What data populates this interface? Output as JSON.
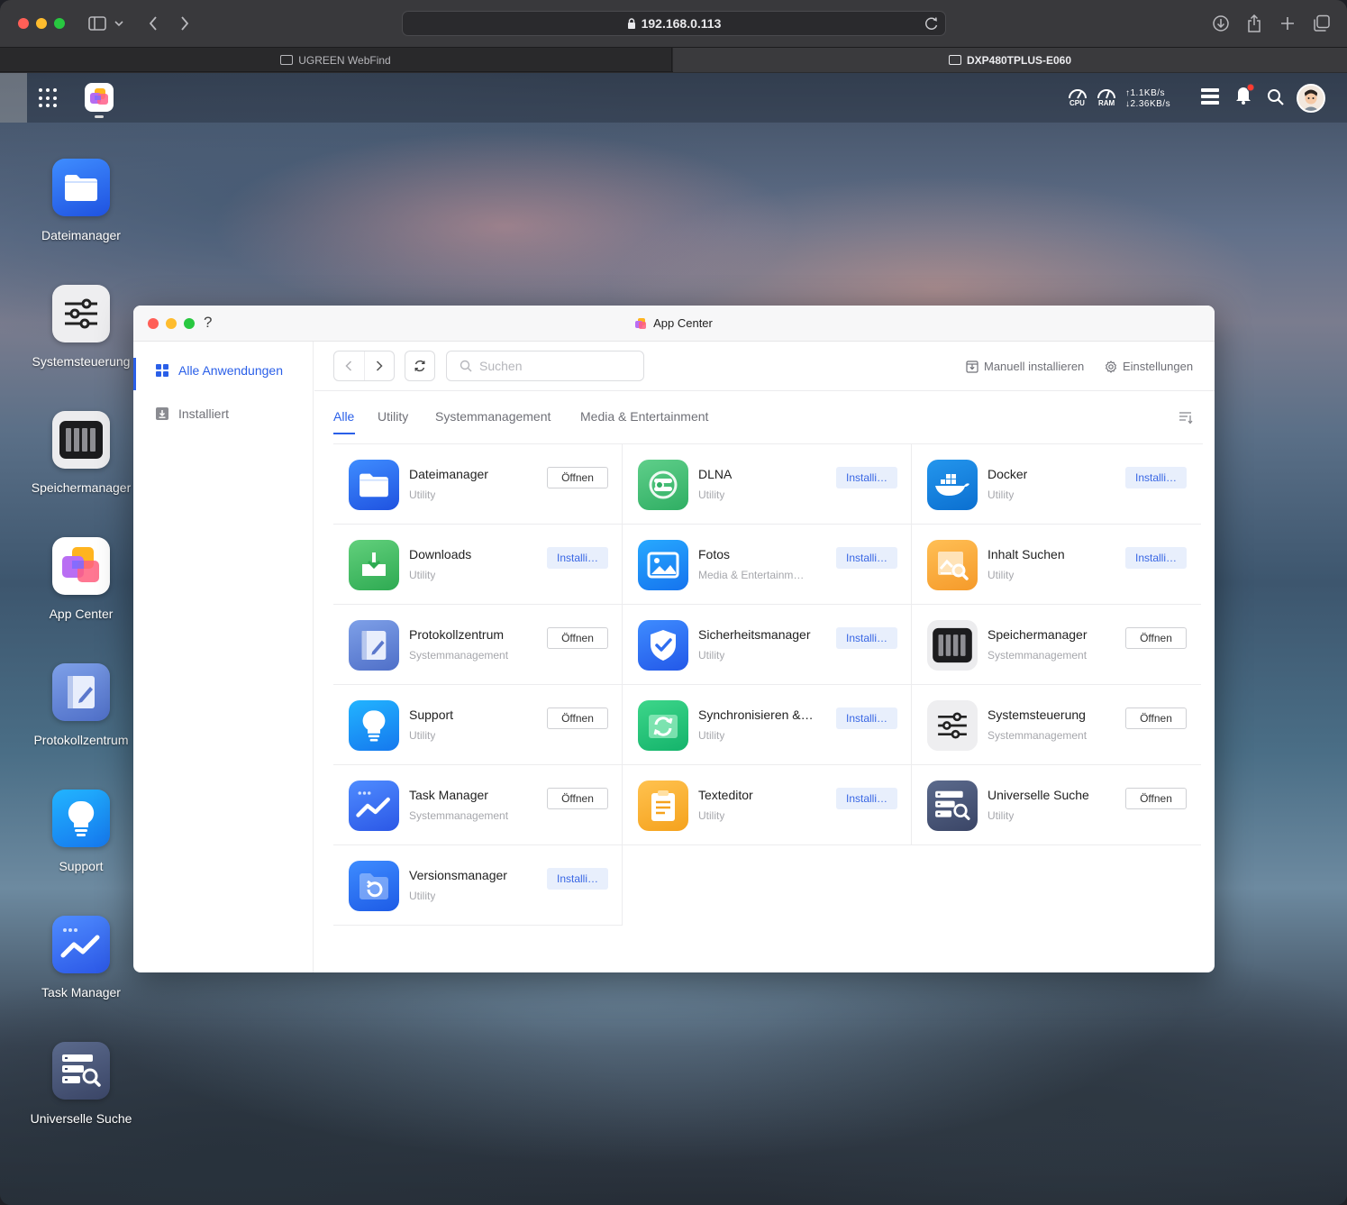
{
  "browser": {
    "url": "192.168.0.113",
    "tabs": [
      {
        "label": "UGREEN WebFind",
        "active": false
      },
      {
        "label": "DXP480TPLUS-E060",
        "active": true
      }
    ]
  },
  "system_bar": {
    "cpu_label": "CPU",
    "ram_label": "RAM",
    "upload": "↑1.1KB/s",
    "download": "↓2.36KB/s"
  },
  "desktop_icons": [
    {
      "label": "Dateimanager",
      "icon": "folder-icon"
    },
    {
      "label": "Systemsteuerung",
      "icon": "sliders-icon"
    },
    {
      "label": "Speichermanager",
      "icon": "storage-drive-icon"
    },
    {
      "label": "App Center",
      "icon": "app-center-icon"
    },
    {
      "label": "Protokollzentrum",
      "icon": "log-book-icon"
    },
    {
      "label": "Support",
      "icon": "lightbulb-icon"
    },
    {
      "label": "Task Manager",
      "icon": "chart-trend-icon"
    },
    {
      "label": "Universelle Suche",
      "icon": "search-database-icon"
    }
  ],
  "window": {
    "title": "App Center",
    "help": "?",
    "sidebar": [
      {
        "label": "Alle Anwendungen",
        "active": true
      },
      {
        "label": "Installiert",
        "active": false
      }
    ],
    "search_placeholder": "Suchen",
    "manual_install": "Manuell installieren",
    "settings": "Einstellungen",
    "categories": [
      {
        "label": "Alle",
        "active": true
      },
      {
        "label": "Utility",
        "active": false
      },
      {
        "label": "Systemmanagement",
        "active": false
      },
      {
        "label": "Media & Entertainment",
        "active": false
      }
    ],
    "apps": [
      {
        "name": "Dateimanager",
        "category": "Utility",
        "action": "Öffnen",
        "state": "open",
        "icon": "folder-icon"
      },
      {
        "name": "DLNA",
        "category": "Utility",
        "action": "Installi…",
        "state": "install",
        "icon": "dlna-icon"
      },
      {
        "name": "Docker",
        "category": "Utility",
        "action": "Installi…",
        "state": "install",
        "icon": "docker-whale-icon"
      },
      {
        "name": "Downloads",
        "category": "Utility",
        "action": "Installi…",
        "state": "install",
        "icon": "download-icon"
      },
      {
        "name": "Fotos",
        "category": "Media & Entertainm…",
        "action": "Installi…",
        "state": "install",
        "icon": "photo-icon"
      },
      {
        "name": "Inhalt Suchen",
        "category": "Utility",
        "action": "Installi…",
        "state": "install",
        "icon": "content-search-icon"
      },
      {
        "name": "Protokollzentrum",
        "category": "Systemmanagement",
        "action": "Öffnen",
        "state": "open",
        "icon": "log-book-icon"
      },
      {
        "name": "Sicherheitsmanager",
        "category": "Utility",
        "action": "Installi…",
        "state": "install",
        "icon": "shield-check-icon"
      },
      {
        "name": "Speichermanager",
        "category": "Systemmanagement",
        "action": "Öffnen",
        "state": "open",
        "icon": "storage-drive-icon"
      },
      {
        "name": "Support",
        "category": "Utility",
        "action": "Öffnen",
        "state": "open",
        "icon": "lightbulb-icon"
      },
      {
        "name": "Synchronisieren &…",
        "category": "Utility",
        "action": "Installi…",
        "state": "install",
        "icon": "sync-icon"
      },
      {
        "name": "Systemsteuerung",
        "category": "Systemmanagement",
        "action": "Öffnen",
        "state": "open",
        "icon": "sliders-icon"
      },
      {
        "name": "Task Manager",
        "category": "Systemmanagement",
        "action": "Öffnen",
        "state": "open",
        "icon": "chart-trend-icon"
      },
      {
        "name": "Texteditor",
        "category": "Utility",
        "action": "Installi…",
        "state": "install",
        "icon": "text-editor-icon"
      },
      {
        "name": "Universelle Suche",
        "category": "Utility",
        "action": "Öffnen",
        "state": "open",
        "icon": "search-database-icon"
      },
      {
        "name": "Versionsmanager",
        "category": "Utility",
        "action": "Installi…",
        "state": "install",
        "icon": "version-restore-icon"
      }
    ]
  },
  "colors": {
    "accent": "#2a5fe8",
    "install_bg": "#e8effc",
    "close": "#ff5f57",
    "minimize": "#febc2e",
    "zoom": "#28c840",
    "notification": "#ff3b30"
  }
}
